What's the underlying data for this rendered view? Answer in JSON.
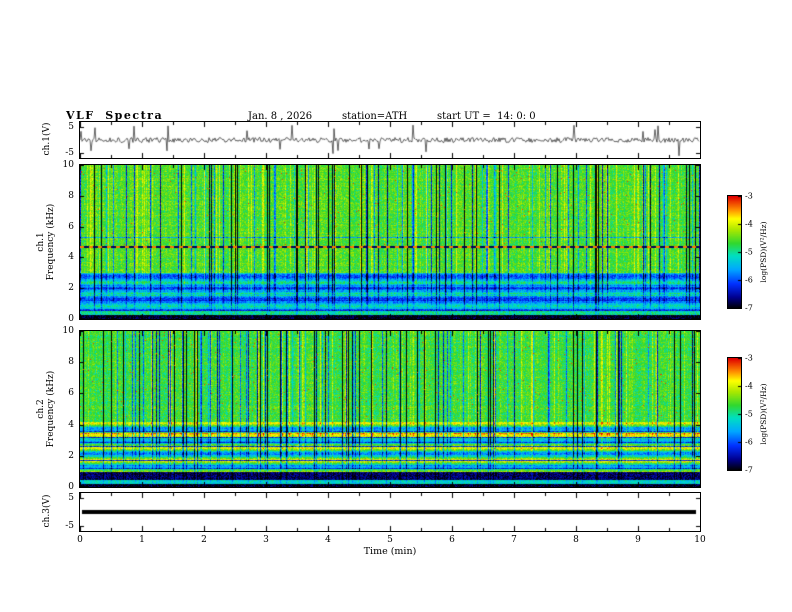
{
  "header": {
    "title": "VLF  Spectra",
    "date": "Jan. 8 , 2026",
    "station": "station=ATH",
    "start_ut": "start UT =  14: 0: 0"
  },
  "axes": {
    "x_label": "Time (min)",
    "x_ticks": [
      "0",
      "1",
      "2",
      "3",
      "4",
      "5",
      "6",
      "7",
      "8",
      "9",
      "10"
    ],
    "freq_ticks": [
      "10",
      "8",
      "6",
      "4",
      "2",
      "0"
    ],
    "volt_ticks": [
      "5",
      "-5"
    ]
  },
  "panels": {
    "wave1": {
      "label": "ch.1(V)"
    },
    "spec1": {
      "ch": "ch.1",
      "axis": "Frequency (kHz)"
    },
    "spec2": {
      "ch": "ch.2",
      "axis": "Frequency (kHz)"
    },
    "wave3": {
      "label": "ch.3(V)"
    }
  },
  "colorbar": {
    "label": "log(PSD)(V²/Hz)",
    "ticks": [
      "-3",
      "-4",
      "-5",
      "-6",
      "-7"
    ]
  },
  "chart_data": {
    "type": "heatmap",
    "title": "VLF Spectra",
    "x": {
      "label": "Time (min)",
      "range": [
        0,
        10
      ],
      "units": "min",
      "grid": false
    },
    "panels": [
      {
        "panel": "ch.1 waveform",
        "type": "line",
        "ylabel": "ch.1(V)",
        "ylim": [
          -5,
          5
        ],
        "yticks": [
          5,
          -5
        ],
        "summary": "dense impulsive VLF waveform centered on 0 V with frequent sferic spikes toward +/-5 V over the full 0-10 min record"
      },
      {
        "panel": "ch.1 spectrogram",
        "type": "heatmap",
        "ylabel": "Frequency (kHz)",
        "ylim": [
          0,
          10
        ],
        "yticks": [
          0,
          2,
          4,
          6,
          8,
          10
        ],
        "zlabel": "log(PSD)(V²/Hz)",
        "zlim": [
          -7,
          -3
        ],
        "summary": "green/yellow broadband background (~ -4.5) above 3 kHz crossed by many vertical dark-blue/black impulse columns; bluer band (~ -6) from 0.5-3 kHz with horizontal striations; near-black band (< -7) below 0.5 kHz; dashed dark/red horizontal line near 4.7 kHz; scattered red speckles (~ -3) at high frequencies"
      },
      {
        "panel": "ch.2 spectrogram",
        "type": "heatmap",
        "ylabel": "Frequency (kHz)",
        "ylim": [
          0,
          10
        ],
        "yticks": [
          0,
          2,
          4,
          6,
          8,
          10
        ],
        "zlabel": "log(PSD)(V²/Hz)",
        "zlim": [
          -7,
          -3
        ],
        "summary": "green background with vertical dark impulse columns above 4 kHz; strong horizontal yellow/green banding with occasional red (~ -3) lines between 1-4 kHz; black band near 0.5-1 kHz; black band below 0.3 kHz"
      },
      {
        "panel": "ch.3 waveform",
        "type": "line",
        "ylabel": "ch.3(V)",
        "ylim": [
          -5,
          5
        ],
        "yticks": [
          5,
          -5
        ],
        "summary": "flat thick black trace constant at 0 V for the whole record"
      }
    ],
    "colormap": [
      {
        "p": 0.0,
        "c": "#000000"
      },
      {
        "p": 0.1,
        "c": "#000090"
      },
      {
        "p": 0.22,
        "c": "#0030ff"
      },
      {
        "p": 0.35,
        "c": "#00a8ff"
      },
      {
        "p": 0.47,
        "c": "#00e0c0"
      },
      {
        "p": 0.58,
        "c": "#30d830"
      },
      {
        "p": 0.7,
        "c": "#a8e800"
      },
      {
        "p": 0.8,
        "c": "#ffff00"
      },
      {
        "p": 0.88,
        "c": "#ff9000"
      },
      {
        "p": 1.0,
        "c": "#e00000"
      }
    ]
  }
}
